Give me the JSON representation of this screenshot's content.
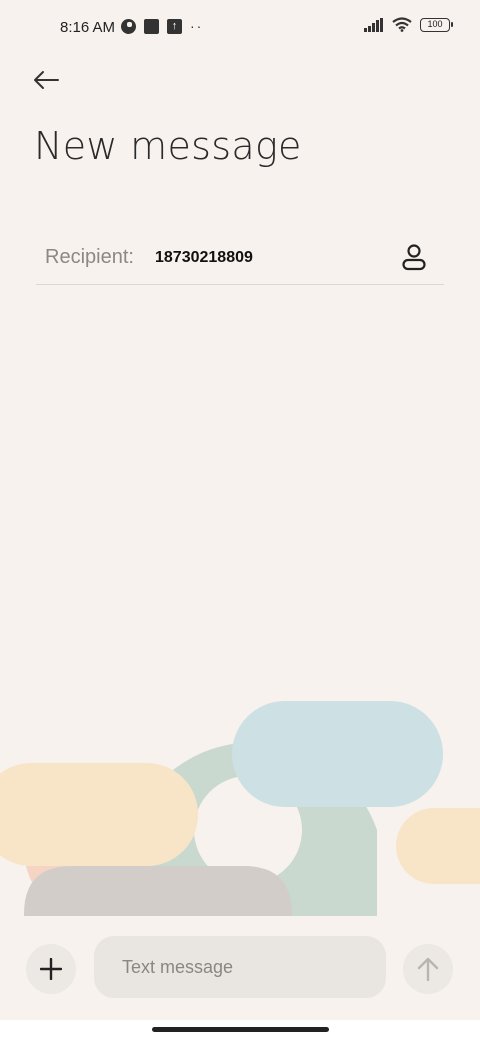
{
  "status_bar": {
    "time": "8:16 AM",
    "dots": "··",
    "battery": "100",
    "icons_left": [
      "app-notification-icon",
      "square-notification-icon",
      "upload-icon",
      "more-dots-icon"
    ],
    "icons_right": [
      "signal-icon",
      "wifi-icon",
      "battery-icon"
    ]
  },
  "header": {
    "title": "New message",
    "back_icon": "back-arrow-icon"
  },
  "recipient": {
    "label": "Recipient:",
    "value": "18730218809",
    "contact_icon": "person-icon"
  },
  "composer": {
    "placeholder": "Text message",
    "attach_icon": "plus-icon",
    "send_icon": "send-arrow-icon"
  },
  "colors": {
    "background": "#f7f2ee",
    "decor_green": "#cad9d0",
    "decor_blue": "#cde0e3",
    "decor_yellow": "#f8e5c7",
    "decor_peach": "#f6d4c4",
    "decor_gray": "#d3cdc9"
  }
}
